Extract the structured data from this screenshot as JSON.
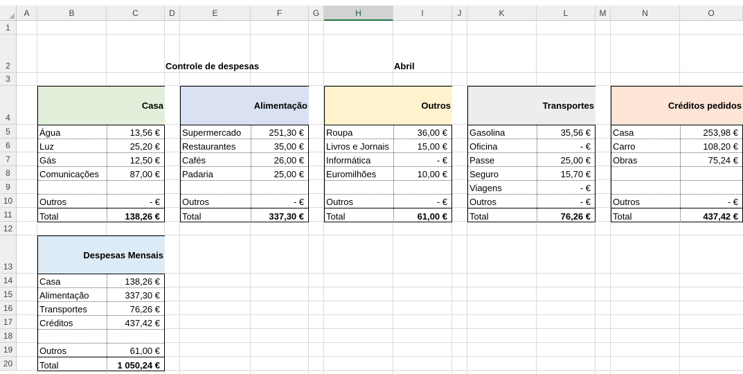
{
  "columns": [
    "A",
    "B",
    "C",
    "D",
    "E",
    "F",
    "G",
    "H",
    "I",
    "J",
    "K",
    "L",
    "M",
    "N",
    "O"
  ],
  "rows": [
    "1",
    "2",
    "3",
    "4",
    "5",
    "6",
    "7",
    "8",
    "9",
    "10",
    "11",
    "12",
    "13",
    "14",
    "15",
    "16",
    "17",
    "18",
    "19",
    "20"
  ],
  "title": "Controle de despesas",
  "month": "Abril",
  "blocks": {
    "casa": {
      "header": "Casa",
      "color": "#e2efda",
      "items": [
        {
          "label": "Água",
          "value": "13,56 €"
        },
        {
          "label": "Luz",
          "value": "25,20 €"
        },
        {
          "label": "Gás",
          "value": "12,50 €"
        },
        {
          "label": "Comunicações",
          "value": "87,00 €"
        },
        {
          "label": "",
          "value": ""
        },
        {
          "label": "Outros",
          "value": "-     €"
        },
        {
          "label": "Total",
          "value": "138,26 €"
        }
      ]
    },
    "alimentacao": {
      "header": "Alimentação",
      "color": "#d9e1f2",
      "items": [
        {
          "label": "Supermercado",
          "value": "251,30 €"
        },
        {
          "label": "Restaurantes",
          "value": "35,00 €"
        },
        {
          "label": "Cafés",
          "value": "26,00 €"
        },
        {
          "label": "Padaria",
          "value": "25,00 €"
        },
        {
          "label": "",
          "value": ""
        },
        {
          "label": "Outros",
          "value": "-     €"
        },
        {
          "label": "Total",
          "value": "337,30 €"
        }
      ]
    },
    "outros": {
      "header": "Outros",
      "color": "#fff2cc",
      "items": [
        {
          "label": "Roupa",
          "value": "36,00 €"
        },
        {
          "label": "Livros e Jornais",
          "value": "15,00 €"
        },
        {
          "label": "Informática",
          "value": "-     €"
        },
        {
          "label": "Euromilhões",
          "value": "10,00 €"
        },
        {
          "label": "",
          "value": ""
        },
        {
          "label": "Outros",
          "value": "-     €"
        },
        {
          "label": "Total",
          "value": "61,00 €"
        }
      ]
    },
    "transportes": {
      "header": "Transportes",
      "color": "#ededed",
      "items": [
        {
          "label": "Gasolina",
          "value": "35,56 €"
        },
        {
          "label": "Oficina",
          "value": "-     €"
        },
        {
          "label": "Passe",
          "value": "25,00 €"
        },
        {
          "label": "Seguro",
          "value": "15,70 €"
        },
        {
          "label": "Viagens",
          "value": "-     €"
        },
        {
          "label": "Outros",
          "value": "-     €"
        },
        {
          "label": "Total",
          "value": "76,26 €"
        }
      ]
    },
    "creditos": {
      "header": "Créditos pedidos",
      "color": "#fce4d6",
      "items": [
        {
          "label": "Casa",
          "value": "253,98 €"
        },
        {
          "label": "Carro",
          "value": "108,20 €"
        },
        {
          "label": "Obras",
          "value": "75,24 €"
        },
        {
          "label": "",
          "value": ""
        },
        {
          "label": "",
          "value": ""
        },
        {
          "label": "Outros",
          "value": "-     €"
        },
        {
          "label": "Total",
          "value": "437,42 €"
        }
      ]
    },
    "mensais": {
      "header": "Despesas Mensais",
      "color": "#ddebf7",
      "items": [
        {
          "label": "Casa",
          "value": "138,26 €"
        },
        {
          "label": "Alimentação",
          "value": "337,30 €"
        },
        {
          "label": "Transportes",
          "value": "76,26 €"
        },
        {
          "label": "Créditos",
          "value": "437,42 €"
        },
        {
          "label": "",
          "value": ""
        },
        {
          "label": "Outros",
          "value": "61,00 €"
        },
        {
          "label": "Total",
          "value": "1 050,24 €"
        }
      ]
    }
  }
}
